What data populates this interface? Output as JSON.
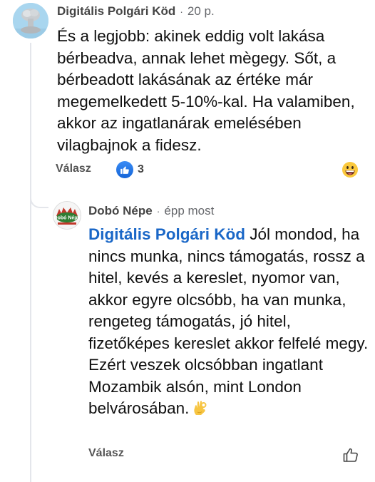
{
  "comment": {
    "author": "Digitális Polgári Köd",
    "time": "20 p.",
    "separator": "·",
    "text": "És a legjobb: akinek eddig volt lakása bérbeadva, annak lehet mègegy. Sőt, a bérbeadott lakásának az értéke már megemelkedett 5-10%-kal. Ha valamiben, akkor az ingatlanárak emelésében vilagbajnok a fidesz.",
    "reply_label": "Válasz",
    "reaction_count": "3",
    "reaction_icon": "like-icon",
    "emoji_button_icon": "grinning-face-icon"
  },
  "reply": {
    "author": "Dobó Népe",
    "avatar_text": "Dobó Népe",
    "time": "épp most",
    "separator": "·",
    "mention": "Digitális Polgári Köd",
    "text": " Jól mondod, ha nincs munka, nincs támogatás, rossz a hitel, kevés a kereslet, nyomor van, akkor egyre olcsóbb, ha van munka, rengeteg támogatás, jó hitel, fizetőképes kereslet akkor felfelé megy. Ezért veszek olcsóbban ingatlant Mozambik alsón, mint London belvárosában.",
    "emoji": "ok-hand-icon",
    "reply_label": "Válasz",
    "like_icon": "thumbs-up-outline-icon"
  },
  "colors": {
    "mention": "#1a67c7",
    "like_blue": "#1877f2",
    "thread_line": "#e4e6eb",
    "meta_gray": "#65676b"
  }
}
